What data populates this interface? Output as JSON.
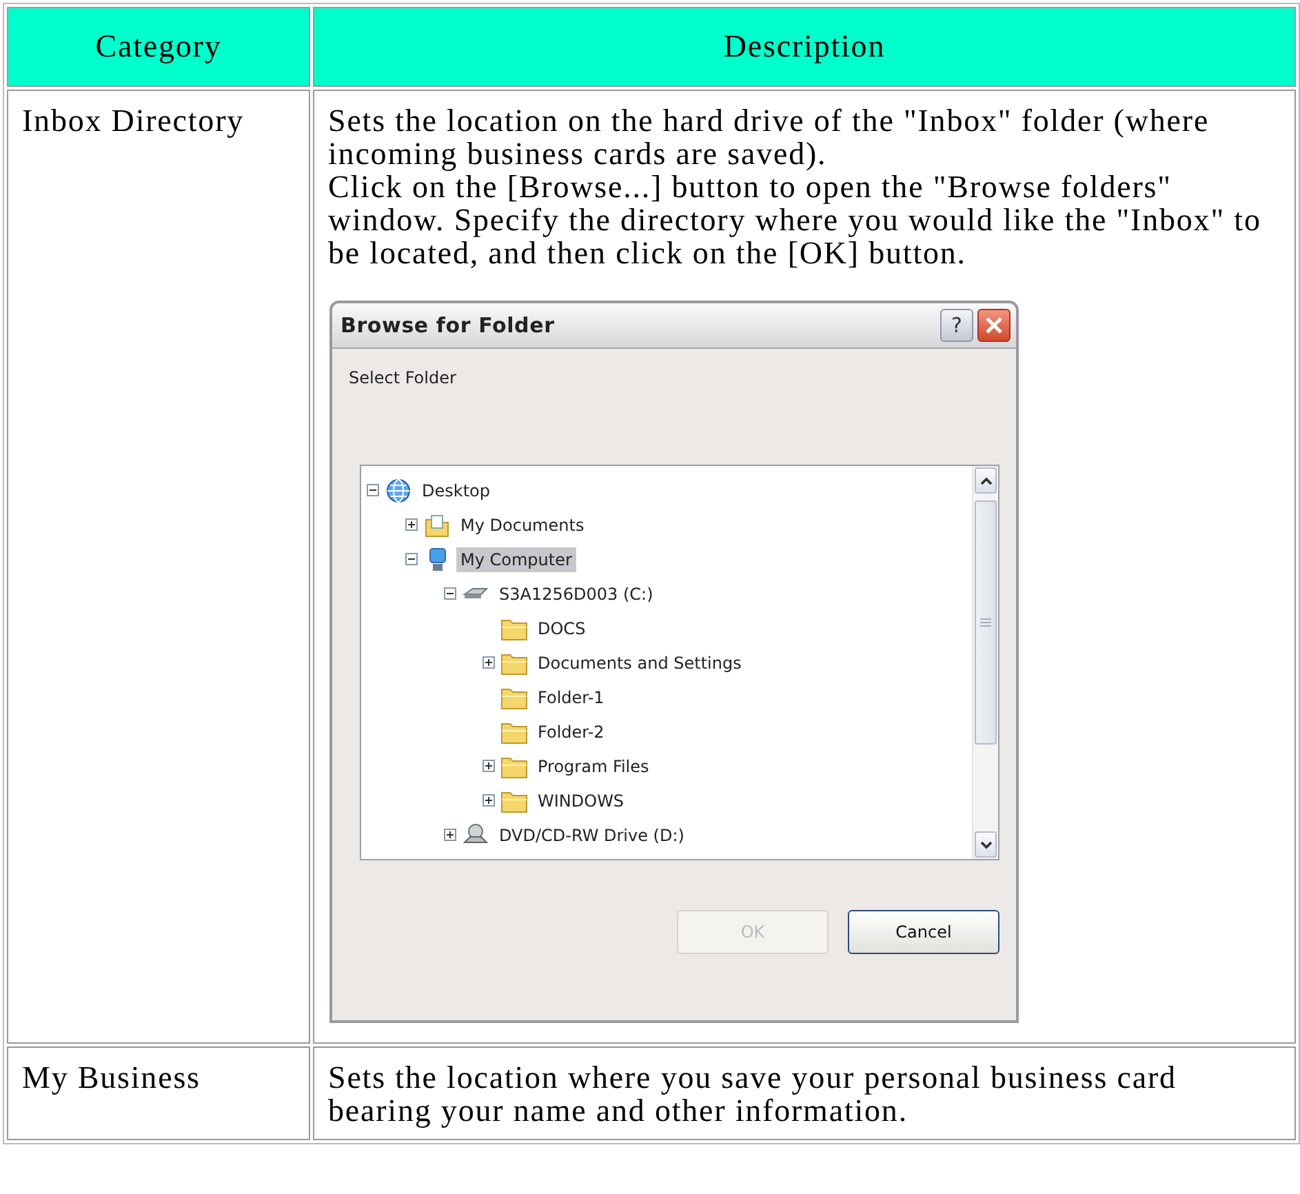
{
  "table": {
    "columns": [
      "Category",
      "Description"
    ],
    "rows": [
      {
        "category": "Inbox Directory",
        "description": [
          "Sets the location on the hard drive of the \"Inbox\" folder (where incoming business cards are saved).",
          "Click on the [Browse...] button to open the \"Browse folders\" window. Specify the directory where you would like the \"Inbox\" to be located, and then click on the [OK] button."
        ],
        "dialog": {
          "title": "Browse for Folder",
          "help": "?",
          "prompt": "Select Folder",
          "tree": [
            {
              "label": "Desktop",
              "kind": "desktop",
              "expanded": true,
              "selected": false,
              "children": [
                {
                  "label": "My Documents",
                  "kind": "documents",
                  "expanded": false,
                  "selected": false
                },
                {
                  "label": "My Computer",
                  "kind": "computer",
                  "expanded": true,
                  "selected": true,
                  "children": [
                    {
                      "label": "S3A1256D003 (C:)",
                      "kind": "drive",
                      "expanded": true,
                      "selected": false,
                      "children": [
                        {
                          "label": "DOCS",
                          "kind": "folder",
                          "selected": false
                        },
                        {
                          "label": "Documents and Settings",
                          "kind": "folder",
                          "expanded": false,
                          "selected": false
                        },
                        {
                          "label": "Folder-1",
                          "kind": "folder",
                          "selected": false
                        },
                        {
                          "label": "Folder-2",
                          "kind": "folder",
                          "selected": false
                        },
                        {
                          "label": "Program Files",
                          "kind": "folder",
                          "expanded": false,
                          "selected": false
                        },
                        {
                          "label": "WINDOWS",
                          "kind": "folder",
                          "expanded": false,
                          "selected": false
                        }
                      ]
                    },
                    {
                      "label": "DVD/CD-RW Drive (D:)",
                      "kind": "cd-drive",
                      "expanded": false,
                      "selected": false
                    }
                  ]
                }
              ]
            }
          ],
          "buttons": [
            {
              "label": "OK",
              "disabled": true
            },
            {
              "label": "Cancel",
              "disabled": false
            }
          ]
        }
      },
      {
        "category": "My Business",
        "description": [
          "Sets the location where you save your personal business card bearing your name and other information."
        ]
      }
    ]
  }
}
